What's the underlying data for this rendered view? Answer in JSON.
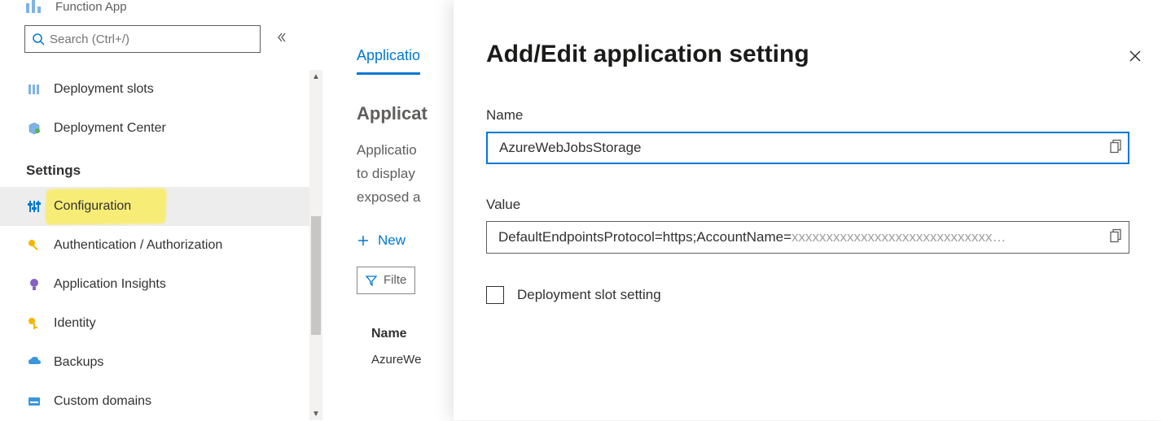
{
  "resource": {
    "type_label": "Function App"
  },
  "search": {
    "placeholder": "Search (Ctrl+/)"
  },
  "sidebar": {
    "items": [
      {
        "label": "Deployment slots"
      },
      {
        "label": "Deployment Center"
      }
    ],
    "section_heading": "Settings",
    "settings_items": [
      {
        "label": "Configuration"
      },
      {
        "label": "Authentication / Authorization"
      },
      {
        "label": "Application Insights"
      },
      {
        "label": "Identity"
      },
      {
        "label": "Backups"
      },
      {
        "label": "Custom domains"
      }
    ]
  },
  "main": {
    "tab_label_partial": "Applicatio",
    "section_title_partial": "Applicat",
    "desc_line1": "Applicatio",
    "desc_line2": "to display",
    "desc_line3": "exposed a",
    "new_label": "New",
    "filter_label": "Filte",
    "column_name": "Name",
    "row0_partial": "AzureWe"
  },
  "panel": {
    "title": "Add/Edit application setting",
    "name_label": "Name",
    "name_value": "AzureWebJobsStorage",
    "value_label": "Value",
    "value_visible": "DefaultEndpointsProtocol=https;AccountName=",
    "value_masked_tail": "xxxxxxxxxxxxxxxxxxxxxxxxxxxxx…",
    "slot_checkbox_label": "Deployment slot setting"
  }
}
